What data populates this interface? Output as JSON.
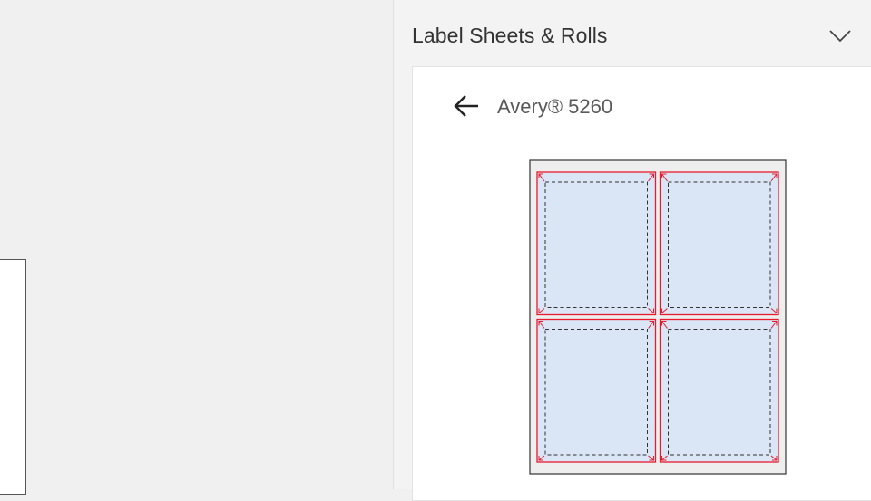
{
  "panel": {
    "title": "Label Sheets & Rolls",
    "collapse_icon": "chevron-down-icon",
    "back_icon": "arrow-left-icon",
    "product_name": "Avery® 5260"
  },
  "sheet_preview": {
    "rows": 2,
    "columns": 2,
    "colors": {
      "sheet_background": "#eeeeee",
      "sheet_border": "#333333",
      "label_fill": "#dae6f6",
      "label_border": "#e81a2c",
      "safe_area_border": "#333333",
      "arrow": "#e81a2c"
    }
  }
}
